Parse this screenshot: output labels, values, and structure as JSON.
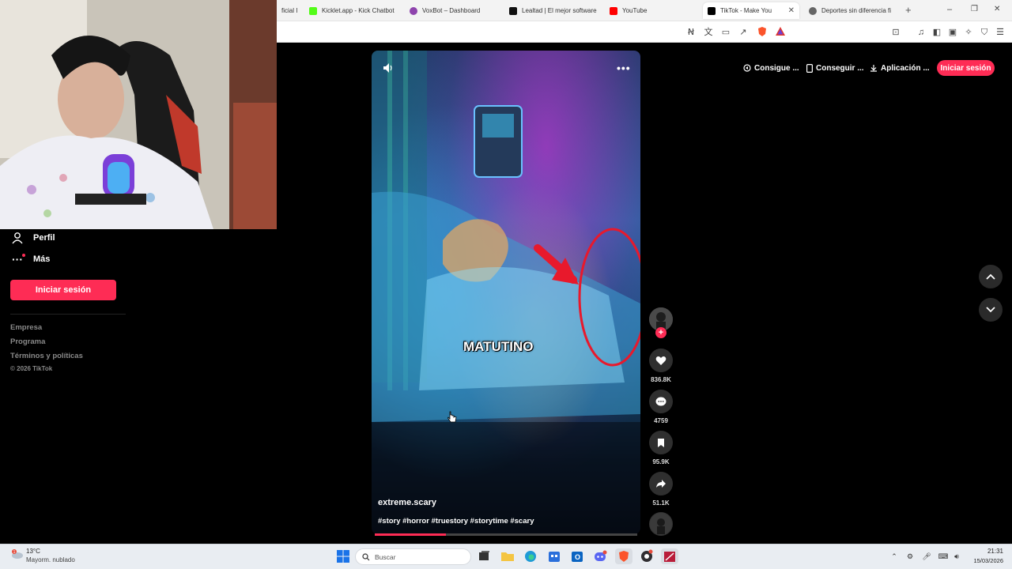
{
  "browser": {
    "tabs": [
      {
        "label": "ficial I",
        "color": "#888888"
      },
      {
        "label": "Kicklet.app - Kick Chatbot",
        "color": "#53fc18"
      },
      {
        "label": "VoxBot – Dashboard",
        "color": "#8e44ad"
      },
      {
        "label": "Lealtad | El mejor software",
        "color": "#111111"
      },
      {
        "label": "YouTube",
        "color": "#ff0000"
      },
      {
        "label": "TikTok - Make You",
        "color": "#000000",
        "active": true
      },
      {
        "label": "Deportes sin diferencia fi",
        "color": "#555555"
      }
    ],
    "new_tab": "+",
    "window_controls": {
      "minimize": "–",
      "maximize": "❐",
      "close": "✕"
    }
  },
  "header": {
    "link_1": "Consigue ...",
    "link_2": "Conseguir ...",
    "link_3": "Aplicación ...",
    "login": "Iniciar sesión"
  },
  "sidebar": {
    "profile": "Perfil",
    "more": "Más",
    "login": "Iniciar sesión",
    "footer": {
      "company": "Empresa",
      "program": "Programa",
      "terms": "Términos y políticas",
      "copyright": "© 2026 TikTok"
    }
  },
  "video": {
    "caption_overlay": "MATUTINO",
    "author": "extreme.scary",
    "hashtags": "#story #horror #truestory #storytime #scary",
    "progress": 0.27
  },
  "actions": {
    "likes": "836.8K",
    "comments": "4759",
    "saves": "95.9K",
    "shares": "51.1K"
  },
  "taskbar": {
    "weather_temp": "13°C",
    "weather_desc": "Mayorm. nublado",
    "search_placeholder": "Buscar",
    "time": "21:31",
    "date": "15/03/2026"
  }
}
